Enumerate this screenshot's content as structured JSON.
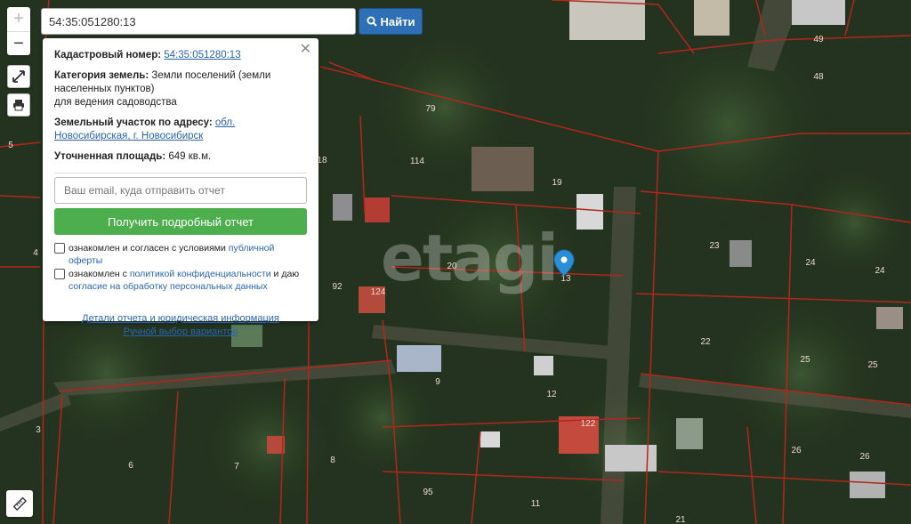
{
  "search": {
    "value": "54:35:051280:13",
    "button_label": "Найти"
  },
  "controls": {
    "zoom_in": "+",
    "zoom_out": "−"
  },
  "info": {
    "cadastral_label": "Кадастровый номер:",
    "cadastral_value": "54:35:051280:13",
    "category_label": "Категория земель:",
    "category_value": "Земли поселений (земли населенных пунктов)",
    "category_value2": "для ведения садоводства",
    "address_label": "Земельный участок по адресу:",
    "address_value": "обл. Новосибирская, г. Новосибирск",
    "area_label": "Уточненная площадь:",
    "area_value": "649 кв.м.",
    "email_placeholder": "Ваш email, куда отправить отчет",
    "report_button": "Получить подробный отчет",
    "consent1_text": "ознакомлен и согласен с условиями",
    "consent1_link": "публичной оферты",
    "consent2_text": "ознакомлен с",
    "consent2_link": "политикой конфиденциальности",
    "consent2_text2": "и даю",
    "consent2_link2": "согласие на обработку персональных данных",
    "details_link": "Детали отчета и юридическая информация",
    "manual_link": "Ручной выбор вариантов"
  },
  "watermark": "etagi",
  "map_labels": [
    "5",
    "4",
    "3",
    "6",
    "7",
    "8",
    "95",
    "11",
    "12",
    "122",
    "9",
    "20",
    "19",
    "114",
    "79",
    "18",
    "92",
    "124",
    "13",
    "23",
    "24",
    "24",
    "22",
    "25",
    "25",
    "26",
    "26",
    "49",
    "48",
    "21"
  ],
  "colors": {
    "accent": "#2f6fb5",
    "green_button": "#4cae4c",
    "parcel_lines": "#b3261e",
    "marker": "#2b8fd6"
  }
}
